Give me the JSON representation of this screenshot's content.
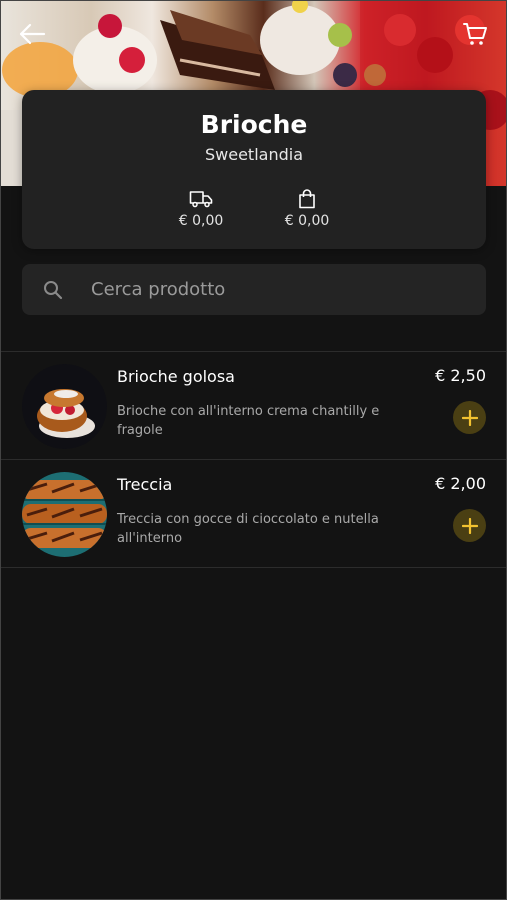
{
  "header": {
    "back_icon": "arrow-left-icon",
    "cart_icon": "shopping-cart-icon"
  },
  "store": {
    "name": "Brioche",
    "subtitle": "Sweetlandia",
    "delivery_fee": "€ 0,00",
    "bag_fee": "€ 0,00"
  },
  "search": {
    "placeholder": "Cerca prodotto",
    "value": ""
  },
  "products": [
    {
      "name": "Brioche golosa",
      "description": "Brioche con all'interno crema chantilly e fragole",
      "price": "€ 2,50"
    },
    {
      "name": "Treccia",
      "description": "Treccia con gocce di cioccolato e nutella all'interno",
      "price": "€ 2,00"
    }
  ],
  "colors": {
    "background": "#131313",
    "card": "#222222",
    "accent": "#f2c230",
    "add_button_bg": "#4a3f13"
  }
}
